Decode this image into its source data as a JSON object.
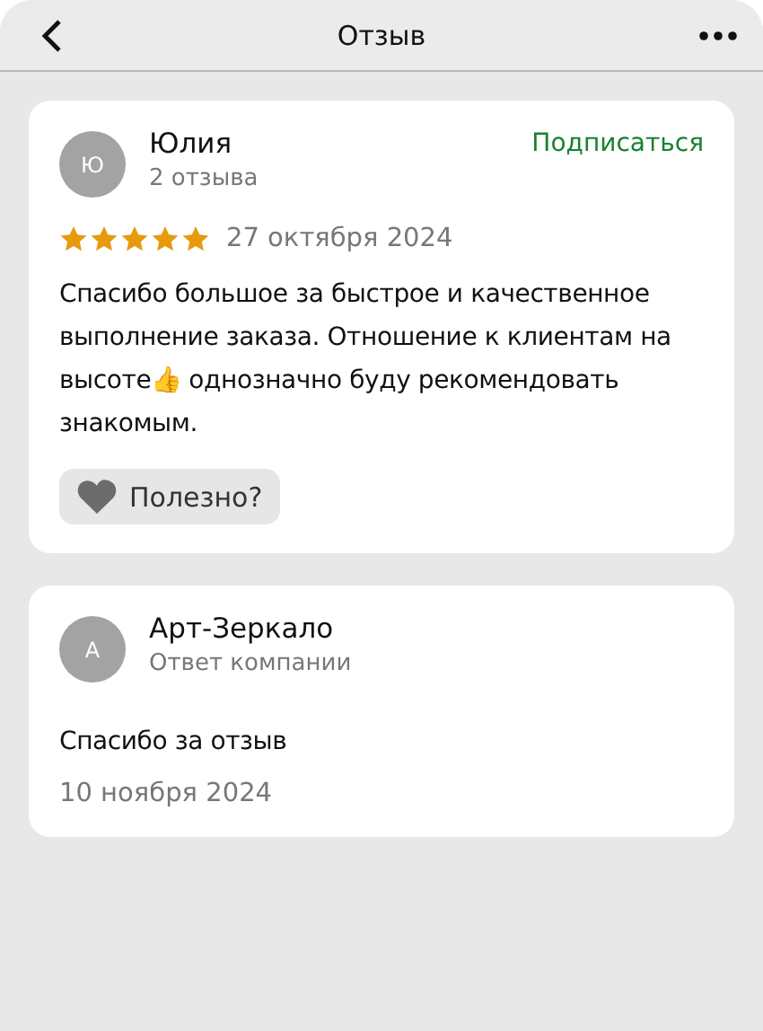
{
  "header": {
    "title": "Отзыв"
  },
  "review": {
    "avatar": "Ю",
    "author": "Юлия",
    "reviews_count": "2 отзыва",
    "subscribe": "Подписаться",
    "stars": 5,
    "date": "27 октября 2024",
    "text": "Спасибо большое за быстрое и качественное выполнение заказа. Отношение к клиентам на высоте👍 однозначно буду рекомендовать знакомым.",
    "helpful": "Полезно?"
  },
  "reply": {
    "avatar": "А",
    "author": "Арт-Зеркало",
    "role": "Ответ компании",
    "text": "Спасибо за отзыв",
    "date": "10 ноября 2024"
  }
}
